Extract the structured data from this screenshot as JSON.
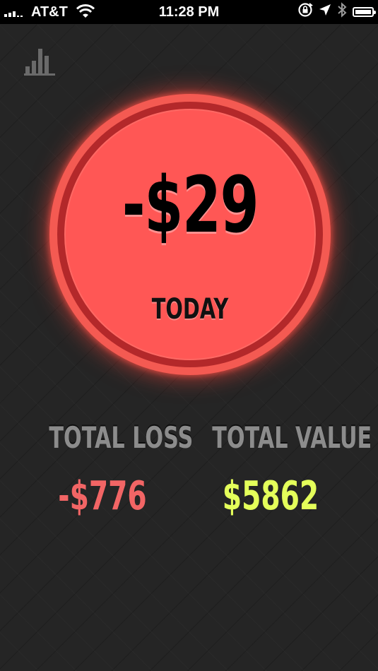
{
  "status_bar": {
    "carrier": "AT&T",
    "time": "11:28 PM",
    "icons": [
      "signal-icon",
      "wifi-icon",
      "rotation-lock-icon",
      "location-icon",
      "bluetooth-icon",
      "battery-icon"
    ]
  },
  "header": {
    "stats_icon": "bar-chart-icon"
  },
  "today": {
    "amount": "-$29",
    "label": "TODAY",
    "color": "#ff5755"
  },
  "totals": {
    "loss_label": "TOTAL LOSS",
    "loss_value": "-$776",
    "loss_color": "#f26565",
    "value_label": "TOTAL VALUE",
    "value_value": "$5862",
    "value_color": "#e4ff5a"
  }
}
